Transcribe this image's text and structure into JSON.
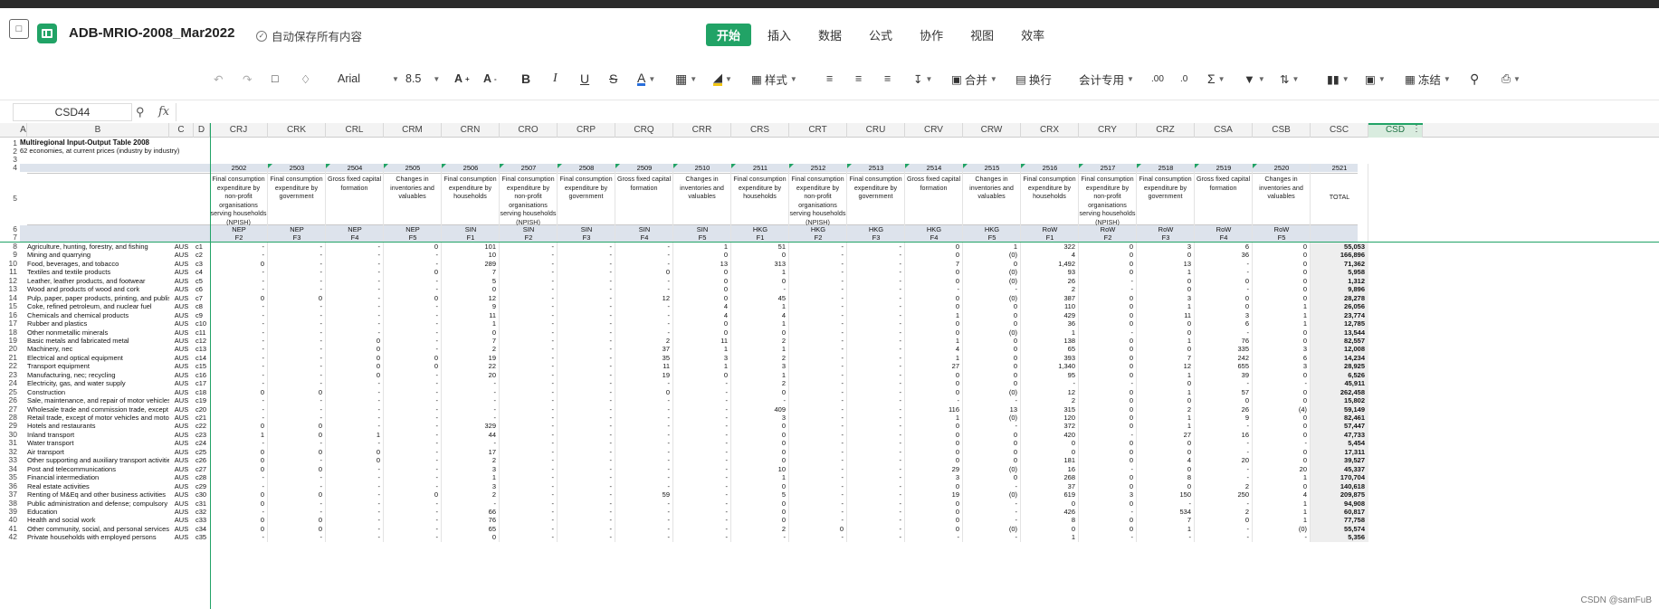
{
  "app": {
    "doc_title": "ADB-MRIO-2008_Mar2022",
    "autosave": "自动保存所有内容",
    "tabs": [
      "开始",
      "插入",
      "数据",
      "公式",
      "协作",
      "视图",
      "效率"
    ],
    "active_tab": "开始",
    "accent": "#21a366"
  },
  "toolbar": {
    "font": "Arial",
    "size": "8.5",
    "style_label": "样式",
    "merge_label": "合并",
    "wrap_label": "换行",
    "numfmt_label": "会计专用",
    "freeze_label": "冻结",
    "icons": [
      "undo-icon",
      "redo-icon",
      "format-painter-icon",
      "eraser-icon",
      "increase-font-icon",
      "decrease-font-icon",
      "bold-icon",
      "italic-icon",
      "underline-icon",
      "strikethrough-icon",
      "font-color-icon",
      "border-icon",
      "fill-color-icon",
      "align-left-icon",
      "align-center-icon",
      "align-right-icon",
      "valign-icon",
      "decimal-increase-icon",
      "decimal-decrease-icon",
      "sum-icon",
      "filter-icon",
      "sort-icon",
      "chart-icon",
      "image-icon",
      "search-icon",
      "print-icon"
    ]
  },
  "formula_bar": {
    "name_box": "CSD44",
    "fx": "fx"
  },
  "sheet": {
    "columns": [
      "A",
      "B",
      "C",
      "D",
      "CRJ",
      "CRK",
      "CRL",
      "CRM",
      "CRN",
      "CRO",
      "CRP",
      "CRQ",
      "CRR",
      "CRS",
      "CRT",
      "CRU",
      "CRV",
      "CRW",
      "CRX",
      "CRY",
      "CRZ",
      "CSA",
      "CSB",
      "CSC",
      "CSD"
    ],
    "selected_column": "CSD",
    "title": "Multiregional Input-Output Table 2008",
    "subtitle": "62 economies, at current prices (industry by industry)",
    "codes": [
      "2502",
      "2503",
      "2504",
      "2505",
      "2506",
      "2507",
      "2508",
      "2509",
      "2510",
      "2511",
      "2512",
      "2513",
      "2514",
      "2515",
      "2516",
      "2517",
      "2518",
      "2519",
      "2520",
      "2521"
    ],
    "descriptions": [
      "Final consumption expenditure by non-profit organisations serving households (NPISH)",
      "Final consumption expenditure by government",
      "Gross fixed capital formation",
      "Changes in inventories and valuables",
      "Final consumption expenditure by households",
      "Final consumption expenditure by non-profit organisations serving households (NPISH)",
      "Final consumption expenditure by government",
      "Gross fixed capital formation",
      "Changes in inventories and valuables",
      "Final consumption expenditure by households",
      "Final consumption expenditure by non-profit organisations serving households (NPISH)",
      "Final consumption expenditure by government",
      "Gross fixed capital formation",
      "Changes in inventories and valuables",
      "Final consumption expenditure by households",
      "Final consumption expenditure by non-profit organisations serving households (NPISH)",
      "Final consumption expenditure by government",
      "Gross fixed capital formation",
      "Changes in inventories and valuables",
      "TOTAL"
    ],
    "regions": [
      "NEP",
      "NEP",
      "NEP",
      "NEP",
      "SIN",
      "SIN",
      "SIN",
      "SIN",
      "SIN",
      "HKG",
      "HKG",
      "HKG",
      "HKG",
      "HKG",
      "RoW",
      "RoW",
      "RoW",
      "RoW",
      "RoW",
      ""
    ],
    "fcodes": [
      "F2",
      "F3",
      "F4",
      "F5",
      "F1",
      "F2",
      "F3",
      "F4",
      "F5",
      "F1",
      "F2",
      "F3",
      "F4",
      "F5",
      "F1",
      "F2",
      "F3",
      "F4",
      "F5",
      ""
    ],
    "rows": [
      {
        "n": "8",
        "name": "Agriculture, hunting, forestry, and fishing",
        "eco": "AUS",
        "c": "c1",
        "v": [
          "-",
          "-",
          "-",
          "0",
          "101",
          "-",
          "-",
          "-",
          "1",
          "51",
          "-",
          "-",
          "0",
          "1",
          "322",
          "0",
          "3",
          "6",
          "0",
          "55,053"
        ]
      },
      {
        "n": "9",
        "name": "Mining and quarrying",
        "eco": "AUS",
        "c": "c2",
        "v": [
          "-",
          "-",
          "-",
          "-",
          "10",
          "-",
          "-",
          "-",
          "0",
          "0",
          "-",
          "-",
          "0",
          "(0)",
          "4",
          "0",
          "0",
          "36",
          "0",
          "166,896"
        ]
      },
      {
        "n": "10",
        "name": "Food, beverages, and tobacco",
        "eco": "AUS",
        "c": "c3",
        "v": [
          "0",
          "-",
          "-",
          "-",
          "289",
          "-",
          "-",
          "-",
          "13",
          "313",
          "-",
          "-",
          "7",
          "0",
          "1,492",
          "0",
          "13",
          "-",
          "0",
          "71,362"
        ]
      },
      {
        "n": "11",
        "name": "Textiles and textile products",
        "eco": "AUS",
        "c": "c4",
        "v": [
          "-",
          "-",
          "-",
          "0",
          "7",
          "-",
          "-",
          "0",
          "0",
          "1",
          "-",
          "-",
          "0",
          "(0)",
          "93",
          "0",
          "1",
          "-",
          "0",
          "5,958"
        ]
      },
      {
        "n": "12",
        "name": "Leather, leather products, and footwear",
        "eco": "AUS",
        "c": "c5",
        "v": [
          "-",
          "-",
          "-",
          "-",
          "5",
          "-",
          "-",
          "-",
          "0",
          "0",
          "-",
          "-",
          "0",
          "(0)",
          "26",
          "-",
          "0",
          "0",
          "0",
          "1,312"
        ]
      },
      {
        "n": "13",
        "name": "Wood and products of wood and cork",
        "eco": "AUS",
        "c": "c6",
        "v": [
          "-",
          "-",
          "-",
          "-",
          "0",
          "-",
          "-",
          "-",
          "0",
          "-",
          "-",
          "-",
          "-",
          "-",
          "2",
          "-",
          "0",
          "-",
          "0",
          "9,896"
        ]
      },
      {
        "n": "14",
        "name": "Pulp, paper, paper products, printing, and publishing",
        "eco": "AUS",
        "c": "c7",
        "v": [
          "0",
          "0",
          "-",
          "0",
          "12",
          "-",
          "-",
          "12",
          "0",
          "45",
          "-",
          "-",
          "0",
          "(0)",
          "387",
          "0",
          "3",
          "0",
          "0",
          "28,278"
        ]
      },
      {
        "n": "15",
        "name": "Coke, refined petroleum, and nuclear fuel",
        "eco": "AUS",
        "c": "c8",
        "v": [
          "-",
          "-",
          "-",
          "-",
          "9",
          "-",
          "-",
          "-",
          "4",
          "1",
          "-",
          "-",
          "0",
          "0",
          "110",
          "0",
          "1",
          "0",
          "1",
          "26,056"
        ]
      },
      {
        "n": "16",
        "name": "Chemicals and chemical products",
        "eco": "AUS",
        "c": "c9",
        "v": [
          "-",
          "-",
          "-",
          "-",
          "11",
          "-",
          "-",
          "-",
          "4",
          "4",
          "-",
          "-",
          "1",
          "0",
          "429",
          "0",
          "11",
          "3",
          "1",
          "23,774"
        ]
      },
      {
        "n": "17",
        "name": "Rubber and plastics",
        "eco": "AUS",
        "c": "c10",
        "v": [
          "-",
          "-",
          "-",
          "-",
          "1",
          "-",
          "-",
          "-",
          "0",
          "1",
          "-",
          "-",
          "0",
          "0",
          "36",
          "0",
          "0",
          "6",
          "1",
          "12,785"
        ]
      },
      {
        "n": "18",
        "name": "Other nonmetallic minerals",
        "eco": "AUS",
        "c": "c11",
        "v": [
          "-",
          "-",
          "-",
          "-",
          "0",
          "-",
          "-",
          "-",
          "0",
          "0",
          "-",
          "-",
          "0",
          "(0)",
          "1",
          "-",
          "0",
          "-",
          "0",
          "13,544"
        ]
      },
      {
        "n": "19",
        "name": "Basic metals and fabricated metal",
        "eco": "AUS",
        "c": "c12",
        "v": [
          "-",
          "-",
          "0",
          "-",
          "7",
          "-",
          "-",
          "2",
          "11",
          "2",
          "-",
          "-",
          "1",
          "0",
          "138",
          "0",
          "1",
          "76",
          "0",
          "82,557"
        ]
      },
      {
        "n": "20",
        "name": "Machinery, nec",
        "eco": "AUS",
        "c": "c13",
        "v": [
          "-",
          "-",
          "0",
          "-",
          "2",
          "-",
          "-",
          "37",
          "1",
          "1",
          "-",
          "-",
          "4",
          "0",
          "65",
          "0",
          "0",
          "335",
          "3",
          "12,008"
        ]
      },
      {
        "n": "21",
        "name": "Electrical and optical equipment",
        "eco": "AUS",
        "c": "c14",
        "v": [
          "-",
          "-",
          "0",
          "0",
          "19",
          "-",
          "-",
          "35",
          "3",
          "2",
          "-",
          "-",
          "1",
          "0",
          "393",
          "0",
          "7",
          "242",
          "6",
          "14,234"
        ]
      },
      {
        "n": "22",
        "name": "Transport equipment",
        "eco": "AUS",
        "c": "c15",
        "v": [
          "-",
          "-",
          "0",
          "0",
          "22",
          "-",
          "-",
          "11",
          "1",
          "3",
          "-",
          "-",
          "27",
          "0",
          "1,340",
          "0",
          "12",
          "655",
          "3",
          "28,925"
        ]
      },
      {
        "n": "23",
        "name": "Manufacturing, nec; recycling",
        "eco": "AUS",
        "c": "c16",
        "v": [
          "-",
          "-",
          "0",
          "-",
          "20",
          "-",
          "-",
          "19",
          "0",
          "1",
          "-",
          "-",
          "0",
          "0",
          "95",
          "0",
          "1",
          "39",
          "0",
          "6,526"
        ]
      },
      {
        "n": "24",
        "name": "Electricity, gas, and water supply",
        "eco": "AUS",
        "c": "c17",
        "v": [
          "-",
          "-",
          "-",
          "-",
          "-",
          "-",
          "-",
          "-",
          "-",
          "2",
          "-",
          "-",
          "0",
          "0",
          "-",
          "-",
          "0",
          "-",
          "-",
          "45,911"
        ]
      },
      {
        "n": "25",
        "name": "Construction",
        "eco": "AUS",
        "c": "c18",
        "v": [
          "0",
          "0",
          "-",
          "-",
          "-",
          "-",
          "-",
          "0",
          "-",
          "0",
          "-",
          "-",
          "0",
          "(0)",
          "12",
          "0",
          "1",
          "57",
          "0",
          "262,458"
        ]
      },
      {
        "n": "26",
        "name": "Sale, maintenance, and repair of motor vehicles and mo",
        "eco": "AUS",
        "c": "c19",
        "v": [
          "-",
          "-",
          "-",
          "-",
          "-",
          "-",
          "-",
          "-",
          "-",
          "-",
          "-",
          "-",
          "-",
          "-",
          "2",
          "0",
          "0",
          "0",
          "0",
          "15,802"
        ]
      },
      {
        "n": "27",
        "name": "Wholesale trade and commission trade, except of moto",
        "eco": "AUS",
        "c": "c20",
        "v": [
          "-",
          "-",
          "-",
          "-",
          "-",
          "-",
          "-",
          "-",
          "-",
          "409",
          "-",
          "-",
          "116",
          "13",
          "315",
          "0",
          "2",
          "26",
          "(4)",
          "59,149"
        ]
      },
      {
        "n": "28",
        "name": "Retail trade, except of motor vehicles and motorcycles",
        "eco": "AUS",
        "c": "c21",
        "v": [
          "-",
          "-",
          "-",
          "-",
          "-",
          "-",
          "-",
          "-",
          "-",
          "3",
          "-",
          "-",
          "1",
          "(0)",
          "120",
          "0",
          "1",
          "9",
          "0",
          "82,461"
        ]
      },
      {
        "n": "29",
        "name": "Hotels and restaurants",
        "eco": "AUS",
        "c": "c22",
        "v": [
          "0",
          "0",
          "-",
          "-",
          "329",
          "-",
          "-",
          "-",
          "-",
          "0",
          "-",
          "-",
          "0",
          "-",
          "372",
          "0",
          "1",
          "-",
          "0",
          "57,447"
        ]
      },
      {
        "n": "30",
        "name": "Inland transport",
        "eco": "AUS",
        "c": "c23",
        "v": [
          "1",
          "0",
          "1",
          "-",
          "44",
          "-",
          "-",
          "-",
          "-",
          "0",
          "-",
          "-",
          "0",
          "0",
          "420",
          "-",
          "27",
          "16",
          "0",
          "47,733"
        ]
      },
      {
        "n": "31",
        "name": "Water transport",
        "eco": "AUS",
        "c": "c24",
        "v": [
          "-",
          "-",
          "-",
          "-",
          "-",
          "-",
          "-",
          "-",
          "-",
          "0",
          "-",
          "-",
          "0",
          "0",
          "0",
          "0",
          "0",
          "-",
          "-",
          "5,454"
        ]
      },
      {
        "n": "32",
        "name": "Air transport",
        "eco": "AUS",
        "c": "c25",
        "v": [
          "0",
          "0",
          "0",
          "-",
          "17",
          "-",
          "-",
          "-",
          "-",
          "0",
          "-",
          "-",
          "0",
          "0",
          "0",
          "0",
          "0",
          "-",
          "0",
          "17,311"
        ]
      },
      {
        "n": "33",
        "name": "Other supporting and auxiliary transport activities; activ",
        "eco": "AUS",
        "c": "c26",
        "v": [
          "0",
          "-",
          "0",
          "-",
          "2",
          "-",
          "-",
          "-",
          "-",
          "0",
          "-",
          "-",
          "0",
          "0",
          "181",
          "0",
          "4",
          "20",
          "0",
          "39,527"
        ]
      },
      {
        "n": "34",
        "name": "Post and telecommunications",
        "eco": "AUS",
        "c": "c27",
        "v": [
          "0",
          "0",
          "-",
          "-",
          "3",
          "-",
          "-",
          "-",
          "-",
          "10",
          "-",
          "-",
          "29",
          "(0)",
          "16",
          "-",
          "0",
          "-",
          "20",
          "45,337"
        ]
      },
      {
        "n": "35",
        "name": "Financial intermediation",
        "eco": "AUS",
        "c": "c28",
        "v": [
          "-",
          "-",
          "-",
          "-",
          "1",
          "-",
          "-",
          "-",
          "-",
          "1",
          "-",
          "-",
          "3",
          "0",
          "268",
          "0",
          "8",
          "-",
          "1",
          "170,704"
        ]
      },
      {
        "n": "36",
        "name": "Real estate activities",
        "eco": "AUS",
        "c": "c29",
        "v": [
          "-",
          "-",
          "-",
          "-",
          "3",
          "-",
          "-",
          "-",
          "-",
          "0",
          "-",
          "-",
          "0",
          "-",
          "37",
          "0",
          "0",
          "2",
          "0",
          "140,618"
        ]
      },
      {
        "n": "37",
        "name": "Renting of M&Eq and other business activities",
        "eco": "AUS",
        "c": "c30",
        "v": [
          "0",
          "0",
          "-",
          "0",
          "2",
          "-",
          "-",
          "59",
          "-",
          "5",
          "-",
          "-",
          "19",
          "(0)",
          "619",
          "3",
          "150",
          "250",
          "4",
          "209,875"
        ]
      },
      {
        "n": "38",
        "name": "Public administration and defense; compulsory social s",
        "eco": "AUS",
        "c": "c31",
        "v": [
          "0",
          "-",
          "-",
          "-",
          "-",
          "-",
          "-",
          "-",
          "-",
          "0",
          "-",
          "-",
          "0",
          "-",
          "0",
          "0",
          "-",
          "-",
          "1",
          "94,908"
        ]
      },
      {
        "n": "39",
        "name": "Education",
        "eco": "AUS",
        "c": "c32",
        "v": [
          "-",
          "-",
          "-",
          "-",
          "66",
          "-",
          "-",
          "-",
          "-",
          "0",
          "-",
          "-",
          "0",
          "-",
          "426",
          "-",
          "534",
          "2",
          "1",
          "60,817"
        ]
      },
      {
        "n": "40",
        "name": "Health and social work",
        "eco": "AUS",
        "c": "c33",
        "v": [
          "0",
          "0",
          "-",
          "-",
          "76",
          "-",
          "-",
          "-",
          "-",
          "0",
          "-",
          "-",
          "0",
          "-",
          "8",
          "0",
          "7",
          "0",
          "1",
          "77,758"
        ]
      },
      {
        "n": "41",
        "name": "Other community, social, and personal services",
        "eco": "AUS",
        "c": "c34",
        "v": [
          "0",
          "0",
          "-",
          "-",
          "65",
          "-",
          "-",
          "-",
          "-",
          "2",
          "0",
          "-",
          "0",
          "(0)",
          "0",
          "0",
          "1",
          "-",
          "(0)",
          "55,574"
        ]
      },
      {
        "n": "42",
        "name": "Private households with employed persons",
        "eco": "AUS",
        "c": "c35",
        "v": [
          "-",
          "-",
          "-",
          "-",
          "0",
          "-",
          "-",
          "-",
          "-",
          "-",
          "-",
          "-",
          "-",
          "-",
          "1",
          "-",
          "-",
          "-",
          "-",
          "5,356"
        ]
      }
    ],
    "watermark": "CSDN @samFuB"
  }
}
